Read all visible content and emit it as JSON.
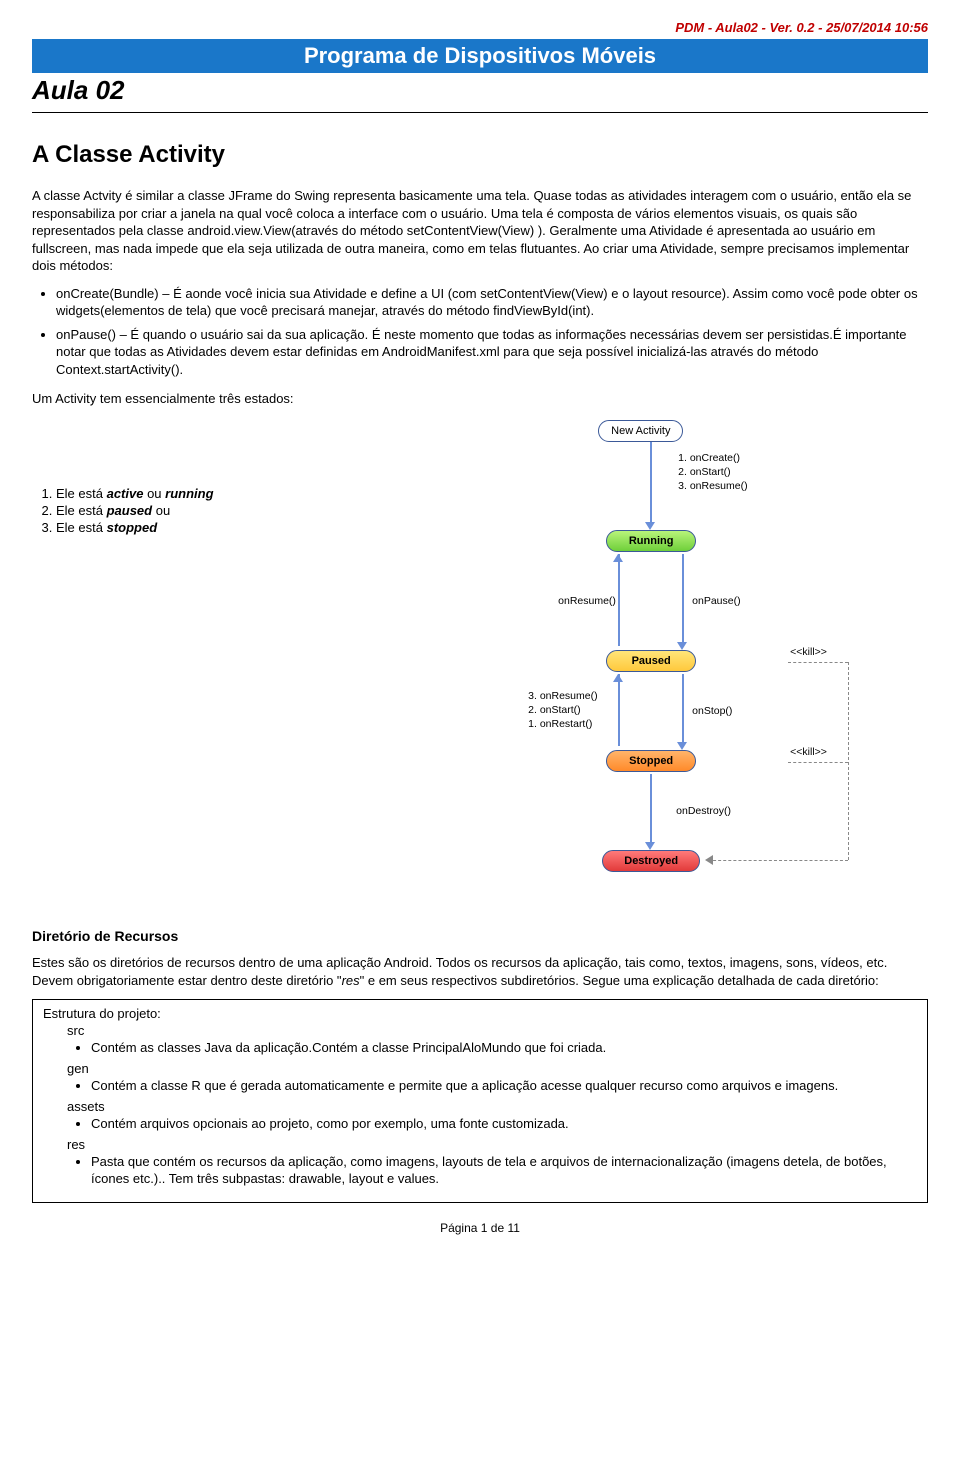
{
  "header": {
    "meta": "PDM - Aula02 - Ver. 0.2 - 25/07/2014 10:56",
    "program": "Programa de Dispositivos Móveis",
    "lesson": "Aula 02"
  },
  "main": {
    "title": "A Classe Activity",
    "para1": "A classe Actvity é similar a classe JFrame do Swing representa basicamente uma tela. Quase todas as atividades interagem com o usuário, então ela se responsabiliza por criar a janela na qual você coloca a interface com o usuário. Uma tela é composta de vários elementos visuais, os quais são representados pela classe android.view.View(através do método setContentView(View) ). Geralmente uma Atividade é apresentada ao usuário em fullscreen, mas nada impede que ela seja utilizada de outra maneira, como em telas flutuantes. Ao criar uma Atividade, sempre precisamos implementar dois métodos:",
    "bullets1": [
      "onCreate(Bundle) – É aonde você inicia sua Atividade e define a UI (com setContentView(View) e o layout resource). Assim como você pode obter os widgets(elementos de tela) que você precisará manejar, através do método findViewById(int).",
      "onPause() – É quando o usuário sai da sua aplicação. É neste momento que todas as informações necessárias devem ser persistidas.É importante notar que todas as Atividades devem estar definidas em AndroidManifest.xml para que seja possível inicializá-las através do método  Context.startActivity()."
    ],
    "statesIntro": "Um Activity tem essencialmente três estados:",
    "states": {
      "s1a": "Ele está ",
      "s1b": "active",
      "s1c": " ou ",
      "s1d": "running",
      "s2a": "Ele está ",
      "s2b": "paused",
      "s2c": " ou",
      "s3a": "Ele está ",
      "s3b": "stopped"
    }
  },
  "diagram": {
    "new": "New Activity",
    "running": "Running",
    "paused": "Paused",
    "stopped": "Stopped",
    "destroyed": "Destroyed",
    "l1": "1.  onCreate()",
    "l2": "2.  onStart()",
    "l3": "3.  onResume()",
    "onResume": "onResume()",
    "onPause": "onPause()",
    "onStop": "onStop()",
    "onDestroy": "onDestroy()",
    "r1": "3.  onResume()",
    "r2": "2.  onStart()",
    "r3": "1.  onRestart()",
    "kill": "<<kill>>"
  },
  "resources": {
    "title": "Diretório de Recursos",
    "intro_a": "Estes são os diretórios de recursos dentro de uma aplicação Android. Todos os recursos da aplicação, tais como, textos, imagens, sons, vídeos, etc. Devem obrigatoriamente estar dentro deste diretório \"",
    "intro_res": "res",
    "intro_b": "\" e em seus respectivos subdiretórios. Segue uma explicação detalhada de cada diretório:",
    "struct_title": "Estrutura do projeto:",
    "dirs": {
      "src": "src",
      "src_desc": "Contém as classes Java da aplicação.Contém a classe PrincipalAloMundo que foi criada.",
      "gen": "gen",
      "gen_desc": "Contém a classe R que é gerada automaticamente e permite que a aplicação acesse qualquer recurso como arquivos e imagens.",
      "assets": "assets",
      "assets_desc": "Contém arquivos opcionais ao projeto, como por exemplo, uma fonte customizada.",
      "res": "res",
      "res_desc": "Pasta que contém os recursos da aplicação, como imagens, layouts de tela e arquivos de internacionalização (imagens detela, de botões, ícones etc.).. Tem três subpastas: drawable, layout e values."
    }
  },
  "footer": "Página 1 de 11"
}
